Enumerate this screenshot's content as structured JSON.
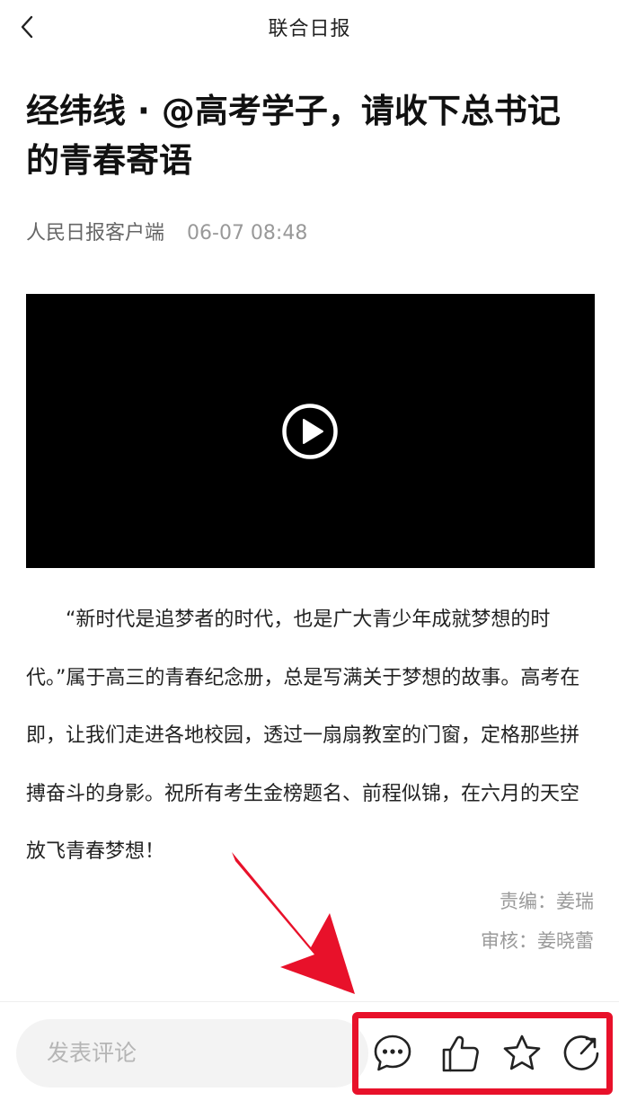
{
  "nav": {
    "title": "联合日报",
    "back_icon": "chevron-left-icon"
  },
  "article": {
    "title_line1": "经纬线 · @高考学子，请收下总书记",
    "title_line2": "的青春寄语",
    "source": "人民日报客户端",
    "time": "06-07 08:48",
    "body": "“新时代是追梦者的时代，也是广大青少年成就梦想的时代。”属于高三的青春纪念册，总是写满关于梦想的故事。高考在即，让我们走进各地校园，透过一扇扇教室的门窗，定格那些拼搏奋斗的身影。祝所有考生金榜题名、前程似锦，在六月的天空放飞青春梦想！",
    "editor": "责编：姜瑞",
    "reviewer": "审核：姜晓蕾"
  },
  "video": {
    "play_icon": "play-circle-icon"
  },
  "bottom_bar": {
    "comment_placeholder": "发表评论",
    "icons": [
      "comment-icon",
      "thumbs-up-icon",
      "star-icon",
      "share-icon"
    ]
  },
  "colors": {
    "highlight": "#e8112a",
    "video_bg": "#000000",
    "meta_gray": "#999999"
  }
}
